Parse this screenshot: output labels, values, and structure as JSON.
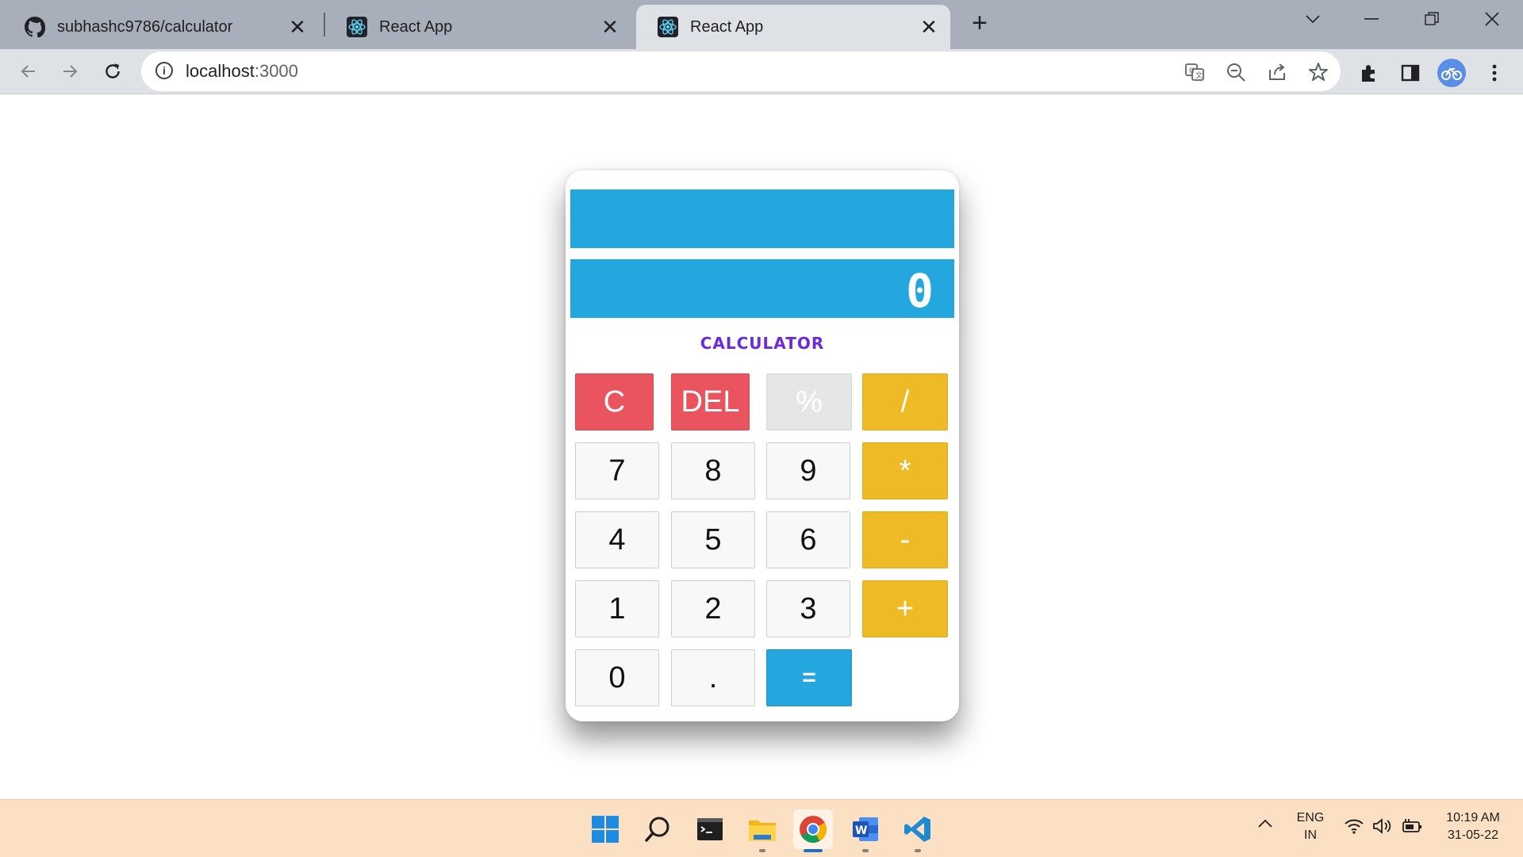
{
  "browser": {
    "tabs": [
      {
        "title": "subhashc9786/calculator",
        "icon": "github-icon"
      },
      {
        "title": "React App",
        "icon": "react-icon"
      },
      {
        "title": "React App",
        "icon": "react-icon",
        "active": true
      }
    ],
    "address": {
      "host": "localhost",
      "port": ":3000"
    }
  },
  "calculator": {
    "previous_display": "",
    "current_display": "0",
    "heading": "CALCULATOR",
    "keys": {
      "clear": "C",
      "delete": "DEL",
      "percent": "%",
      "divide": "/",
      "seven": "7",
      "eight": "8",
      "nine": "9",
      "multiply": "*",
      "four": "4",
      "five": "5",
      "six": "6",
      "subtract": "-",
      "one": "1",
      "two": "2",
      "three": "3",
      "add": "+",
      "zero": "0",
      "dot": ".",
      "equals": "="
    },
    "colors": {
      "screen": "#24a6df",
      "clear": "#e9545f",
      "operator": "#eeba26",
      "heading": "#6b2bd8"
    }
  },
  "taskbar": {
    "apps": [
      "windows-start-icon",
      "search-icon",
      "terminal-icon",
      "file-explorer-icon",
      "chrome-icon",
      "word-icon",
      "vscode-icon"
    ],
    "language": {
      "line1": "ENG",
      "line2": "IN"
    },
    "time": "10:19 AM",
    "date": "31-05-22"
  }
}
